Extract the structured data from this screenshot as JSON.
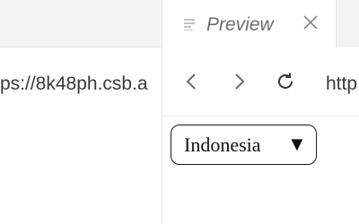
{
  "editor": {
    "url_fragment": "ps://8k48ph.csb.a"
  },
  "preview": {
    "tab": {
      "title": "Preview",
      "icon": "lines-icon",
      "close_icon": "close-icon"
    },
    "nav": {
      "back_icon": "chevron-left-icon",
      "forward_icon": "chevron-right-icon",
      "reload_icon": "refresh-icon",
      "url_fragment": "http"
    },
    "select": {
      "selected": "Indonesia",
      "arrow": "▼"
    }
  }
}
